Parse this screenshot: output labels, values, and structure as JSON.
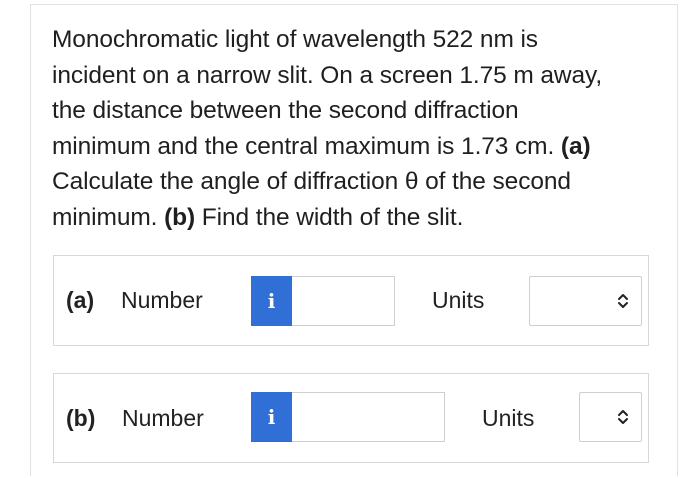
{
  "question": {
    "line1": "Monochromatic light of wavelength 522 nm is",
    "line2": "incident on a narrow slit. On a screen 1.75 m away,",
    "line3": "the distance between the second diffraction",
    "line4_text": "minimum and the central maximum is 1.73 cm.",
    "line4_bold": "(a)",
    "line5": "Calculate the angle of diffraction θ of the second",
    "line6_text": "minimum.",
    "line6_bold": "(b)",
    "line6_tail": "Find the width of the slit."
  },
  "part_a": {
    "label": "(a)",
    "number_label": "Number",
    "info_icon": "i",
    "number_value": "",
    "units_label": "Units",
    "units_value": ""
  },
  "part_b": {
    "label": "(b)",
    "number_label": "Number",
    "info_icon": "i",
    "number_value": "",
    "units_label": "Units",
    "units_value": ""
  },
  "colors": {
    "info_button": "#2f6fd6",
    "border": "#d7d7d7"
  }
}
